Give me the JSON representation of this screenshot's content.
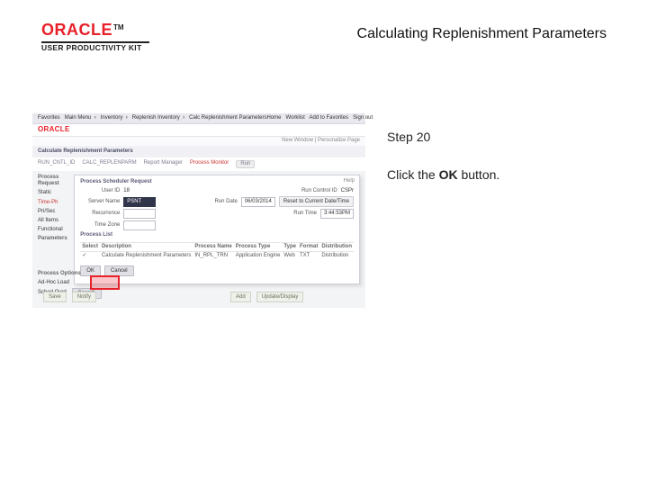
{
  "logo": {
    "word": "ORACLE",
    "tm": "TM",
    "sub": "USER PRODUCTIVITY KIT"
  },
  "title": "Calculating Replenishment Parameters",
  "step": "Step 20",
  "instruction_pre": "Click the ",
  "instruction_bold": "OK",
  "instruction_post": " button.",
  "shot": {
    "toprow": {
      "left": [
        "Favorites",
        "Main Menu",
        "Inventory",
        "Replenish Inventory",
        "Calc Replenishment Parameters"
      ],
      "right": [
        "Home",
        "Worklist",
        "Add to Favorites",
        "Sign out"
      ]
    },
    "brand": "ORACLE",
    "sub": "New Window | Personalize Page",
    "h1": "Calculate Replenishment Parameters",
    "bc": {
      "items": [
        "RUN_CNTL_ID",
        "CALC_REPLENPARM",
        "Report Manager"
      ],
      "red": "Process Monitor",
      "pill": "Run"
    },
    "side": {
      "hd": "Process Request",
      "items": [
        "Static",
        "Time-Ph",
        "Pri/Sec",
        "All Items",
        "Functional"
      ],
      "hd2": "Parameters",
      "red_idx": 1
    },
    "panel": {
      "title": "Process Scheduler Request",
      "close": "Help",
      "fields": {
        "user": {
          "label": "User ID",
          "value": "18"
        },
        "runctl": {
          "label": "Run Control ID",
          "value": "CSPr"
        },
        "server": {
          "label": "Server Name",
          "value": "PSNT"
        },
        "rundate": {
          "label": "Run Date",
          "value": "06/03/2014"
        },
        "recur": {
          "label": "Recurrence",
          "value": ""
        },
        "runtime": {
          "label": "Run Time",
          "value": "3:44:53PM"
        },
        "tz": {
          "label": "Time Zone",
          "value": ""
        },
        "reset": "Reset to Current Date/Time"
      },
      "table": {
        "head": [
          "Select",
          "Description",
          "Process Name",
          "Process Type",
          "Type",
          "Format",
          "Distribution"
        ],
        "row": [
          "✓",
          "Calculate Replenishment Parameters",
          "IN_RPL_TRN",
          "Application Engine",
          "Web",
          "TXT",
          "Distribution"
        ]
      },
      "ok": "OK",
      "cancel": "Cancel"
    },
    "foot": {
      "hd": "Process Options",
      "s1": "Ad-Hoc Load",
      "s2": "Sched Ovrd",
      "btn": "Search"
    },
    "tool": {
      "save": "Save",
      "notify": "Notify",
      "add": "Add",
      "upd": "Update/Display"
    }
  }
}
